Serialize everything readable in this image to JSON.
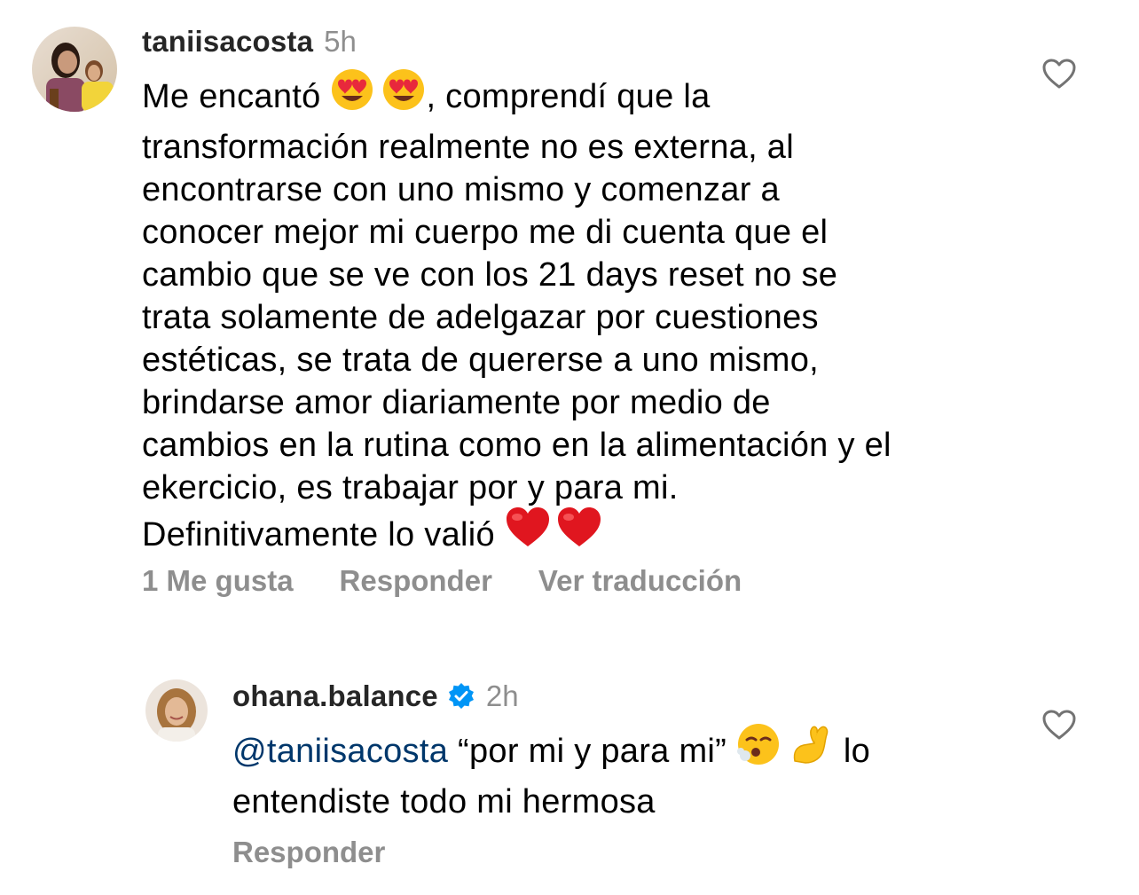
{
  "comments": [
    {
      "username": "taniisacosta",
      "time": "5h",
      "text_part1": "Me encantó ",
      "emoji1": "heart-eyes-emoji",
      "text_part2": ", comprendí que la",
      "lines": [
        "transformación realmente no es externa, al",
        "encontrarse con uno mismo y comenzar a",
        "conocer mejor mi cuerpo me di cuenta que el",
        "cambio que se ve con los 21 days reset no se",
        "trata solamente de adelgazar por cuestiones",
        "estéticas, se trata de quererse a uno mismo,",
        "brindarse amor diariamente por medio de",
        "cambios en la rutina como en la alimentación y el",
        "ekercicio, es trabajar por y para mi."
      ],
      "last_line": "Definitivamente lo valió ",
      "last_emoji": "red-heart-emoji",
      "actions": {
        "likes": "1 Me gusta",
        "reply": "Responder",
        "translate": "Ver traducción"
      }
    },
    {
      "username": "ohana.balance",
      "verified": true,
      "time": "2h",
      "mention": "@taniisacosta",
      "quote": " “por mi y para mi” ",
      "emoji1": "face-exhaling-emoji",
      "emoji2": "pinching-hand-emoji",
      "text_after": " lo",
      "line2": "entendiste todo mi hermosa",
      "actions": {
        "reply": "Responder"
      }
    }
  ],
  "colors": {
    "username": "#262626",
    "secondary": "#8e8e8e",
    "mention": "#00376b",
    "verified": "#0095f6"
  }
}
